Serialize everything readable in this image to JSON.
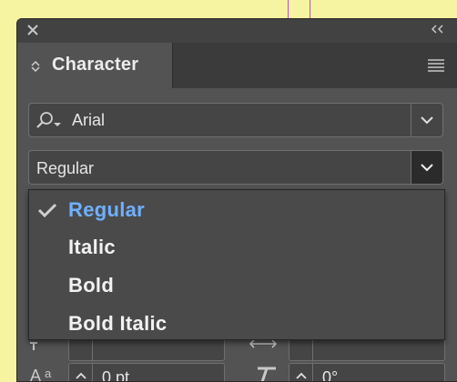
{
  "panel": {
    "title": "Character",
    "font_family": {
      "value": "Arial"
    },
    "font_style": {
      "value": "Regular",
      "options": [
        "Regular",
        "Italic",
        "Bold",
        "Bold Italic"
      ],
      "selected_index": 0
    },
    "font_size": {
      "value": "0 pt"
    },
    "skew": {
      "value": "0°"
    }
  },
  "colors": {
    "selected_item": "#6fb0ff",
    "panel_bg": "#535353",
    "page_bg": "#f6f4a0"
  },
  "icons": [
    "close-icon",
    "collapse-icon",
    "panel-menu-icon",
    "search-icon",
    "chevron-down-icon",
    "checkmark-icon"
  ]
}
